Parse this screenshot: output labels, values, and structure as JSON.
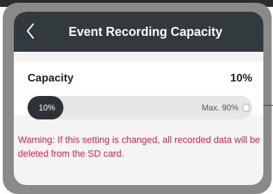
{
  "header": {
    "title": "Event Recording Capacity",
    "back_icon": "chevron-left-icon"
  },
  "capacity": {
    "label": "Capacity",
    "value_text": "10%",
    "slider_value_text": "10%",
    "max_text": "Max. 90%",
    "value_percent": 10,
    "max_percent": 90
  },
  "warning": {
    "text": "Warning: If this setting is changed, all recorded data will be deleted from the SD card."
  },
  "colors": {
    "header_bg": "#333a3e",
    "warning": "#e0284a",
    "slider_fill": "#2c3236",
    "slider_track": "#e6e6e6"
  }
}
